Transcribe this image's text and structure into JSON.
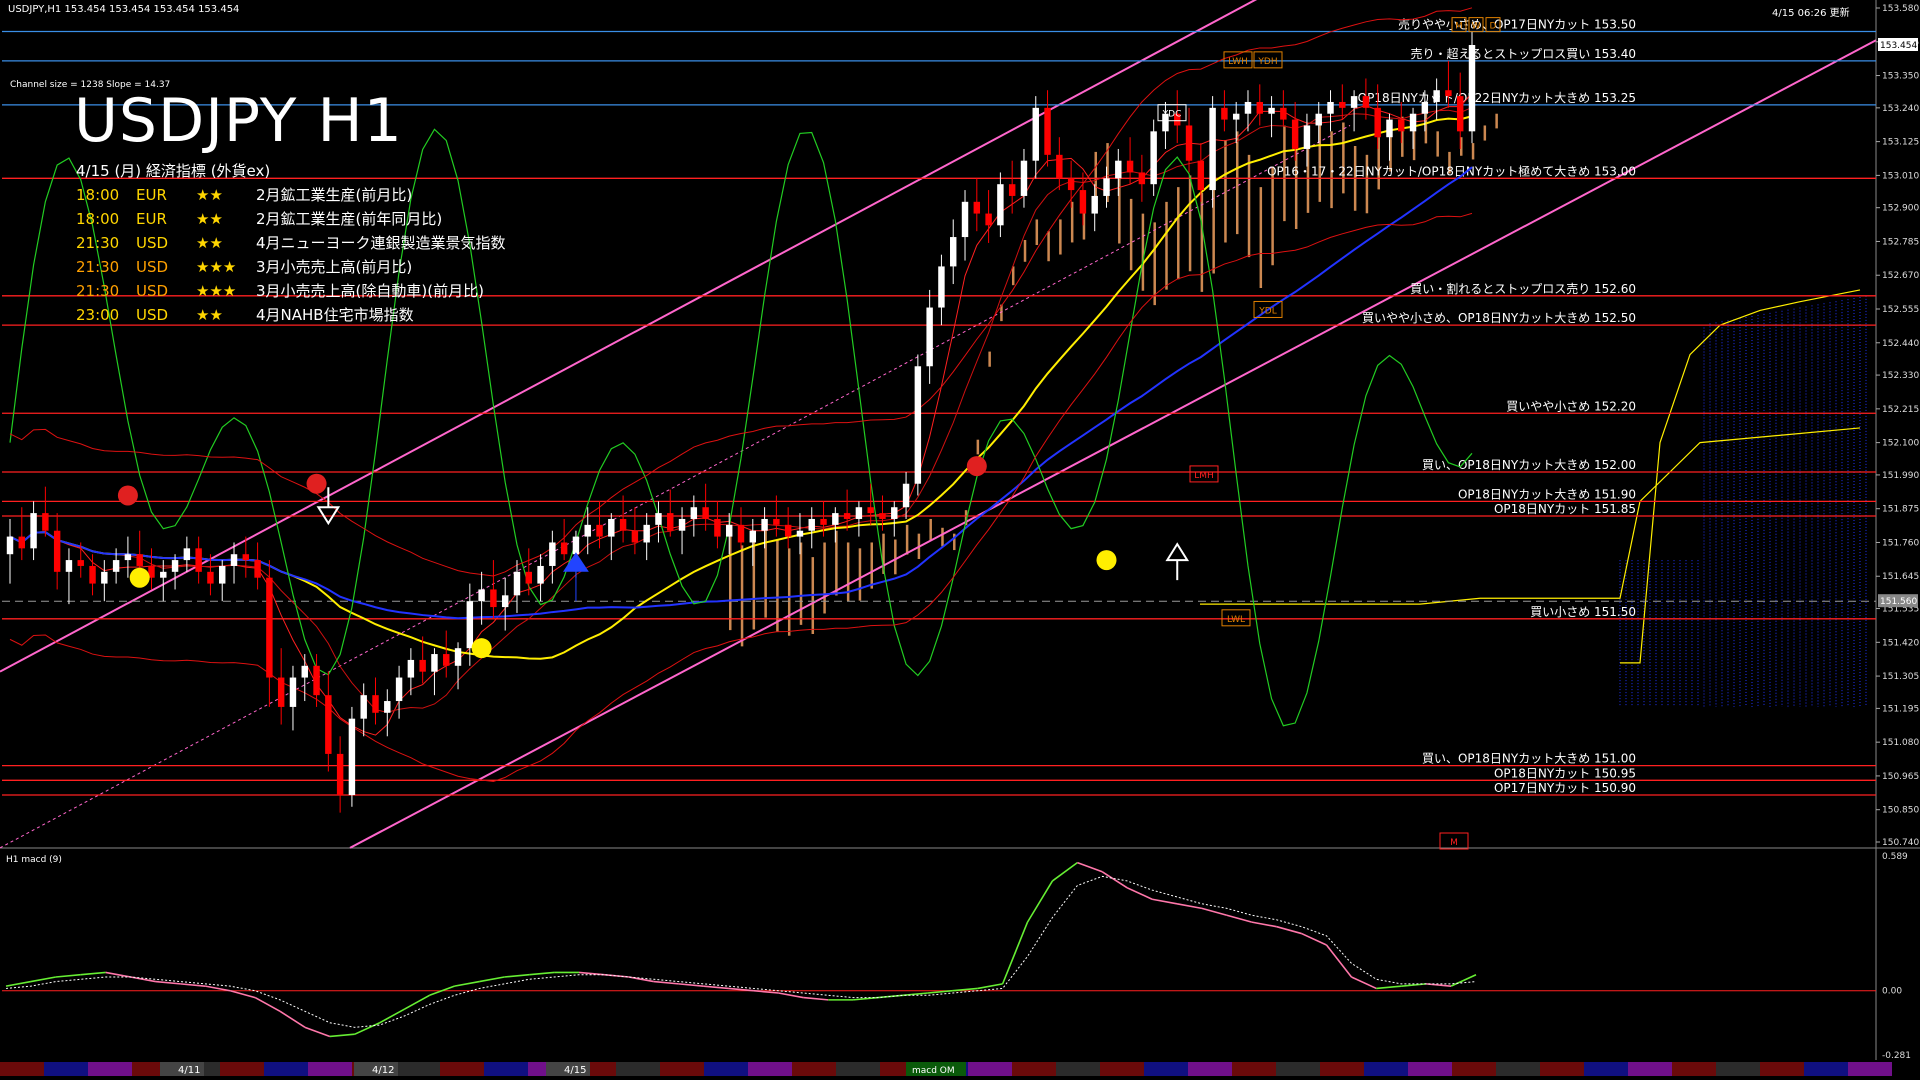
{
  "header": {
    "symbol_line": "USDJPY,H1  153.454 153.454 153.454 153.454",
    "timestamp": "4/15 06:26 更新",
    "channel_info": "Channel size = 1238 Slope = 14.37",
    "title": "USDJPY H1",
    "econ_heading": "4/15 (月) 経済指標 (外貨ex)"
  },
  "economic_indicators": [
    {
      "time": "18:00",
      "currency": "EUR",
      "stars": "★★",
      "name": "2月鉱工業生産(前月比)",
      "color": "#ffd600"
    },
    {
      "time": "18:00",
      "currency": "EUR",
      "stars": "★★",
      "name": "2月鉱工業生産(前年同月比)",
      "color": "#ffd600"
    },
    {
      "time": "21:30",
      "currency": "USD",
      "stars": "★★",
      "name": "4月ニューヨーク連銀製造業景気指数",
      "color": "#ffd600"
    },
    {
      "time": "21:30",
      "currency": "USD",
      "stars": "★★★",
      "name": "3月小売売上高(前月比)",
      "color": "#ffa000"
    },
    {
      "time": "21:30",
      "currency": "USD",
      "stars": "★★★",
      "name": "3月小売売上高(除自動車)(前月比)",
      "color": "#ffa000"
    },
    {
      "time": "23:00",
      "currency": "USD",
      "stars": "★★",
      "name": "4月NAHB住宅市場指数",
      "color": "#ffd600"
    }
  ],
  "colors": {
    "background": "#000000",
    "bull_candle": "#ffffff",
    "bear_candle": "#ff0000",
    "order_line": "#ff2020",
    "blue_line": "#3a8ee6",
    "channel": "#ff66cc",
    "cloud": "#f0a060",
    "macd": "#66ee33",
    "sma_yellow": "#ffee00",
    "sma_blue": "#2233ff",
    "green_osc": "#22cc22"
  },
  "chart_data": [
    {
      "type": "candlestick",
      "title": "USDJPY H1",
      "ylim": [
        150.74,
        153.58
      ],
      "y_ticks": [
        "153.580",
        "153.465",
        "153.350",
        "153.240",
        "153.125",
        "153.010",
        "152.900",
        "152.785",
        "152.670",
        "152.555",
        "152.440",
        "152.330",
        "152.215",
        "152.100",
        "151.990",
        "151.875",
        "151.760",
        "151.645",
        "151.535",
        "151.420",
        "151.305",
        "151.195",
        "151.080",
        "150.965",
        "150.850",
        "150.740"
      ],
      "x_labels": [
        "4/11",
        "4/12",
        "4/15"
      ],
      "current_price": "153.454",
      "ref_price_tag": "151.560",
      "candles_note": "approximate OHLC path",
      "candles": [
        [
          151.72,
          151.84,
          151.62,
          151.78
        ],
        [
          151.78,
          151.88,
          151.7,
          151.74
        ],
        [
          151.74,
          151.9,
          151.7,
          151.86
        ],
        [
          151.86,
          151.95,
          151.78,
          151.8
        ],
        [
          151.8,
          151.86,
          151.6,
          151.66
        ],
        [
          151.66,
          151.74,
          151.55,
          151.7
        ],
        [
          151.7,
          151.76,
          151.64,
          151.68
        ],
        [
          151.68,
          151.72,
          151.58,
          151.62
        ],
        [
          151.62,
          151.7,
          151.56,
          151.66
        ],
        [
          151.66,
          151.74,
          151.62,
          151.7
        ],
        [
          151.7,
          151.78,
          151.64,
          151.72
        ],
        [
          151.72,
          151.8,
          151.66,
          151.68
        ],
        [
          151.68,
          151.74,
          151.6,
          151.64
        ],
        [
          151.64,
          151.7,
          151.56,
          151.66
        ],
        [
          151.66,
          151.72,
          151.6,
          151.7
        ],
        [
          151.7,
          151.78,
          151.66,
          151.74
        ],
        [
          151.74,
          151.78,
          151.62,
          151.66
        ],
        [
          151.66,
          151.72,
          151.58,
          151.62
        ],
        [
          151.62,
          151.7,
          151.56,
          151.68
        ],
        [
          151.68,
          151.76,
          151.62,
          151.72
        ],
        [
          151.72,
          151.78,
          151.64,
          151.7
        ],
        [
          151.7,
          151.76,
          151.6,
          151.64
        ],
        [
          151.64,
          151.7,
          151.2,
          151.3
        ],
        [
          151.3,
          151.4,
          151.14,
          151.2
        ],
        [
          151.2,
          151.34,
          151.12,
          151.3
        ],
        [
          151.3,
          151.38,
          151.22,
          151.34
        ],
        [
          151.34,
          151.38,
          151.2,
          151.24
        ],
        [
          151.24,
          151.32,
          150.98,
          151.04
        ],
        [
          151.04,
          151.1,
          150.84,
          150.9
        ],
        [
          150.9,
          151.2,
          150.86,
          151.16
        ],
        [
          151.16,
          151.28,
          151.1,
          151.24
        ],
        [
          151.24,
          151.3,
          151.14,
          151.18
        ],
        [
          151.18,
          151.26,
          151.1,
          151.22
        ],
        [
          151.22,
          151.34,
          151.16,
          151.3
        ],
        [
          151.3,
          151.4,
          151.24,
          151.36
        ],
        [
          151.36,
          151.44,
          151.28,
          151.32
        ],
        [
          151.32,
          151.4,
          151.24,
          151.38
        ],
        [
          151.38,
          151.46,
          151.3,
          151.34
        ],
        [
          151.34,
          151.42,
          151.26,
          151.4
        ],
        [
          151.4,
          151.62,
          151.34,
          151.56
        ],
        [
          151.56,
          151.66,
          151.48,
          151.6
        ],
        [
          151.6,
          151.7,
          151.5,
          151.54
        ],
        [
          151.54,
          151.64,
          151.46,
          151.58
        ],
        [
          151.58,
          151.7,
          151.52,
          151.66
        ],
        [
          151.66,
          151.74,
          151.58,
          151.62
        ],
        [
          151.62,
          151.72,
          151.56,
          151.68
        ],
        [
          151.68,
          151.8,
          151.62,
          151.76
        ],
        [
          151.76,
          151.84,
          151.7,
          151.72
        ],
        [
          151.72,
          151.8,
          151.64,
          151.78
        ],
        [
          151.78,
          151.88,
          151.72,
          151.82
        ],
        [
          151.82,
          151.9,
          151.74,
          151.78
        ],
        [
          151.78,
          151.86,
          151.7,
          151.84
        ],
        [
          151.84,
          151.92,
          151.76,
          151.8
        ],
        [
          151.8,
          151.88,
          151.72,
          151.76
        ],
        [
          151.76,
          151.86,
          151.7,
          151.82
        ],
        [
          151.82,
          151.9,
          151.76,
          151.86
        ],
        [
          151.86,
          151.94,
          151.78,
          151.8
        ],
        [
          151.8,
          151.88,
          151.72,
          151.84
        ],
        [
          151.84,
          151.92,
          151.78,
          151.88
        ],
        [
          151.88,
          151.96,
          151.8,
          151.84
        ],
        [
          151.84,
          151.9,
          151.74,
          151.78
        ],
        [
          151.78,
          151.86,
          151.72,
          151.82
        ],
        [
          151.82,
          151.88,
          151.74,
          151.76
        ],
        [
          151.76,
          151.84,
          151.68,
          151.8
        ],
        [
          151.8,
          151.88,
          151.74,
          151.84
        ],
        [
          151.84,
          151.92,
          151.78,
          151.82
        ],
        [
          151.82,
          151.88,
          151.74,
          151.78
        ],
        [
          151.78,
          151.86,
          151.72,
          151.8
        ],
        [
          151.8,
          151.88,
          151.74,
          151.84
        ],
        [
          151.84,
          151.9,
          151.78,
          151.82
        ],
        [
          151.82,
          151.88,
          151.76,
          151.86
        ],
        [
          151.86,
          151.94,
          151.8,
          151.84
        ],
        [
          151.84,
          151.9,
          151.78,
          151.88
        ],
        [
          151.88,
          151.96,
          151.82,
          151.86
        ],
        [
          151.86,
          151.92,
          151.8,
          151.84
        ],
        [
          151.84,
          151.9,
          151.78,
          151.88
        ],
        [
          151.88,
          152.0,
          151.84,
          151.96
        ],
        [
          151.96,
          152.4,
          151.92,
          152.36
        ],
        [
          152.36,
          152.62,
          152.3,
          152.56
        ],
        [
          152.56,
          152.74,
          152.5,
          152.7
        ],
        [
          152.7,
          152.86,
          152.64,
          152.8
        ],
        [
          152.8,
          152.96,
          152.72,
          152.92
        ],
        [
          152.92,
          153.0,
          152.82,
          152.88
        ],
        [
          152.88,
          152.96,
          152.78,
          152.84
        ],
        [
          152.84,
          153.02,
          152.8,
          152.98
        ],
        [
          152.98,
          153.06,
          152.88,
          152.94
        ],
        [
          152.94,
          153.1,
          152.9,
          153.06
        ],
        [
          153.06,
          153.28,
          153.0,
          153.24
        ],
        [
          153.24,
          153.3,
          153.04,
          153.08
        ],
        [
          153.08,
          153.14,
          152.96,
          153.0
        ],
        [
          153.0,
          153.06,
          152.9,
          152.96
        ],
        [
          152.96,
          153.02,
          152.84,
          152.88
        ],
        [
          152.88,
          152.98,
          152.82,
          152.94
        ],
        [
          152.94,
          153.04,
          152.9,
          153.0
        ],
        [
          153.0,
          153.1,
          152.94,
          153.06
        ],
        [
          153.06,
          153.14,
          152.98,
          153.02
        ],
        [
          153.02,
          153.08,
          152.92,
          152.98
        ],
        [
          152.98,
          153.2,
          152.94,
          153.16
        ],
        [
          153.16,
          153.26,
          153.1,
          153.22
        ],
        [
          153.22,
          153.3,
          153.12,
          153.18
        ],
        [
          153.18,
          153.24,
          153.02,
          153.06
        ],
        [
          153.06,
          153.12,
          152.92,
          152.96
        ],
        [
          152.96,
          153.28,
          152.9,
          153.24
        ],
        [
          153.24,
          153.3,
          153.16,
          153.2
        ],
        [
          153.2,
          153.26,
          153.12,
          153.22
        ],
        [
          153.22,
          153.3,
          153.16,
          153.26
        ],
        [
          153.26,
          153.32,
          153.18,
          153.22
        ],
        [
          153.22,
          153.28,
          153.14,
          153.24
        ],
        [
          153.24,
          153.3,
          153.18,
          153.2
        ],
        [
          153.2,
          153.26,
          153.06,
          153.1
        ],
        [
          153.1,
          153.22,
          153.04,
          153.18
        ],
        [
          153.18,
          153.26,
          153.12,
          153.22
        ],
        [
          153.22,
          153.3,
          153.16,
          153.26
        ],
        [
          153.26,
          153.32,
          153.2,
          153.24
        ],
        [
          153.24,
          153.3,
          153.16,
          153.28
        ],
        [
          153.28,
          153.34,
          153.2,
          153.24
        ],
        [
          153.24,
          153.32,
          153.1,
          153.14
        ],
        [
          153.14,
          153.22,
          153.06,
          153.2
        ],
        [
          153.2,
          153.26,
          153.12,
          153.16
        ],
        [
          153.16,
          153.24,
          153.1,
          153.22
        ],
        [
          153.22,
          153.3,
          153.16,
          153.26
        ],
        [
          153.26,
          153.34,
          153.2,
          153.3
        ],
        [
          153.3,
          153.4,
          153.24,
          153.28
        ],
        [
          153.28,
          153.36,
          153.1,
          153.16
        ],
        [
          153.16,
          153.5,
          153.12,
          153.454
        ]
      ],
      "order_levels": [
        {
          "price": 153.5,
          "label": "売りやや小さめ、OP17日NYカット 153.50",
          "color": "#3a8ee6"
        },
        {
          "price": 153.4,
          "label": "売り・超えるとストップロス買い 153.40",
          "color": "#3a8ee6"
        },
        {
          "price": 153.25,
          "label": "OP18日NYカット/OP22日NYカット大きめ 153.25",
          "color": "#3a8ee6"
        },
        {
          "price": 153.0,
          "label": "OP16・17・22日NYカット/OP18日NYカット極めて大きめ 153.00",
          "color": "#ff2020"
        },
        {
          "price": 152.6,
          "label": "買い・割れるとストップロス売り 152.60",
          "color": "#ff2020"
        },
        {
          "price": 152.5,
          "label": "買いやや小さめ、OP18日NYカット大きめ 152.50",
          "color": "#ff2020"
        },
        {
          "price": 152.2,
          "label": "買いやや小さめ 152.20",
          "color": "#ff2020"
        },
        {
          "price": 152.0,
          "label": "買い、OP18日NYカット大きめ 152.00",
          "color": "#ff2020"
        },
        {
          "price": 151.9,
          "label": "OP18日NYカット大きめ 151.90",
          "color": "#ff2020"
        },
        {
          "price": 151.85,
          "label": "OP18日NYカット 151.85",
          "color": "#ff2020"
        },
        {
          "price": 151.5,
          "label": "買い小さめ 151.50",
          "color": "#ff2020"
        },
        {
          "price": 151.0,
          "label": "買い、OP18日NYカット大きめ 151.00",
          "color": "#ff2020"
        },
        {
          "price": 150.95,
          "label": "OP18日NYカット 150.95",
          "color": "#ff2020"
        },
        {
          "price": 150.9,
          "label": "OP17日NYカット 150.90",
          "color": "#ff2020"
        }
      ],
      "tags": [
        "LWH",
        "YDH",
        "YDC",
        "YDL",
        "LMH",
        "LWL",
        "M",
        "W",
        "D"
      ]
    },
    {
      "type": "line",
      "title": "H1 macd (9)",
      "ylim": [
        -0.281,
        0.589
      ],
      "y_ticks": [
        "0.589",
        "0.00",
        "-0.281"
      ],
      "series": [
        {
          "name": "macd",
          "values": [
            0.02,
            0.04,
            0.06,
            0.07,
            0.08,
            0.06,
            0.04,
            0.03,
            0.02,
            0.0,
            -0.03,
            -0.09,
            -0.16,
            -0.2,
            -0.19,
            -0.14,
            -0.08,
            -0.02,
            0.02,
            0.04,
            0.06,
            0.07,
            0.08,
            0.08,
            0.07,
            0.06,
            0.04,
            0.03,
            0.02,
            0.01,
            0.0,
            -0.01,
            -0.03,
            -0.04,
            -0.04,
            -0.03,
            -0.02,
            -0.01,
            0.0,
            0.01,
            0.03,
            0.3,
            0.48,
            0.56,
            0.52,
            0.45,
            0.4,
            0.38,
            0.36,
            0.33,
            0.3,
            0.28,
            0.25,
            0.2,
            0.06,
            0.01,
            0.02,
            0.03,
            0.02,
            0.07
          ]
        },
        {
          "name": "signal",
          "values": [
            0.01,
            0.02,
            0.04,
            0.05,
            0.06,
            0.06,
            0.05,
            0.04,
            0.03,
            0.02,
            0.0,
            -0.04,
            -0.09,
            -0.14,
            -0.16,
            -0.15,
            -0.11,
            -0.06,
            -0.02,
            0.01,
            0.03,
            0.05,
            0.06,
            0.07,
            0.07,
            0.06,
            0.05,
            0.04,
            0.03,
            0.02,
            0.01,
            0.0,
            -0.01,
            -0.02,
            -0.03,
            -0.03,
            -0.02,
            -0.02,
            -0.01,
            0.0,
            0.01,
            0.15,
            0.32,
            0.46,
            0.5,
            0.48,
            0.44,
            0.41,
            0.38,
            0.36,
            0.33,
            0.31,
            0.28,
            0.24,
            0.12,
            0.05,
            0.03,
            0.03,
            0.03,
            0.04
          ]
        }
      ],
      "footer_label": "macd OM"
    }
  ]
}
